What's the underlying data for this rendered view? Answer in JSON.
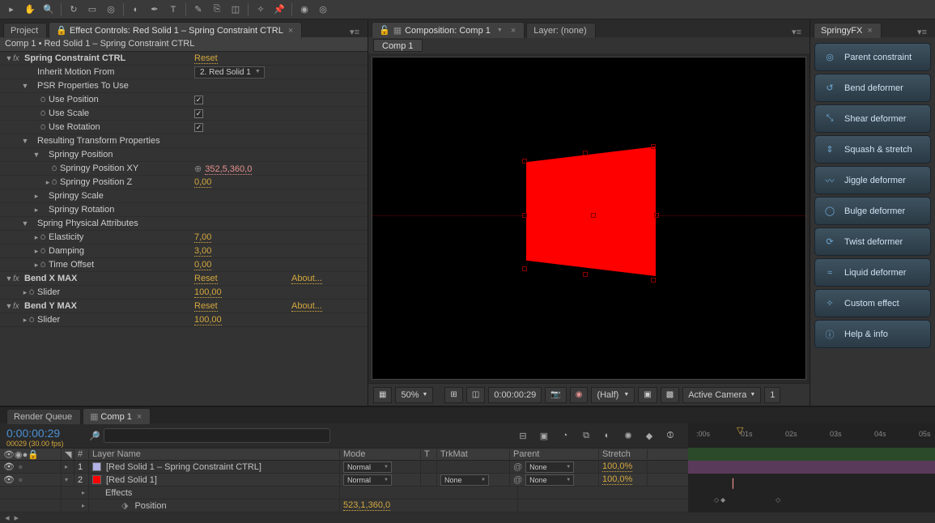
{
  "toolbar": {
    "icons": [
      "pointer",
      "hand",
      "zoom",
      "orbit",
      "camera",
      "dolly",
      "roto",
      "pen",
      "text",
      "brush",
      "clone",
      "pin",
      "puppet",
      "anchor"
    ]
  },
  "leftPanel": {
    "tabs": {
      "project": "Project",
      "effectControls": "Effect Controls: Red Solid 1 – Spring Constraint CTRL"
    },
    "crumb": "Comp 1 • Red Solid 1 – Spring Constraint CTRL",
    "fx": [
      {
        "name": "Spring Constraint CTRL",
        "reset": "Reset",
        "rows": [
          {
            "indent": 1,
            "type": "label",
            "label": "Inherit Motion From",
            "ctrl": "dd",
            "val": "2. Red Solid 1"
          },
          {
            "indent": 1,
            "type": "group",
            "tw": "▼",
            "label": "PSR Properties To Use"
          },
          {
            "indent": 2,
            "type": "check",
            "stop": "Ö",
            "label": "Use Position",
            "checked": true
          },
          {
            "indent": 2,
            "type": "check",
            "stop": "Ö",
            "label": "Use Scale",
            "checked": true
          },
          {
            "indent": 2,
            "type": "check",
            "stop": "Ö",
            "label": "Use Rotation",
            "checked": true
          },
          {
            "indent": 1,
            "type": "group",
            "tw": "▼",
            "label": "Resulting Transform Properties"
          },
          {
            "indent": 2,
            "type": "group",
            "tw": "▼",
            "label": "Springy Position"
          },
          {
            "indent": 3,
            "type": "value",
            "stop": "Ö",
            "label": "Springy Position XY",
            "pre": "⊕",
            "val": "352,5,360,0",
            "valClass": "pinkv"
          },
          {
            "indent": 3,
            "type": "value",
            "tw": "▸",
            "stop": "Ö",
            "label": "Springy Position Z",
            "val": "0,00",
            "valClass": "orange"
          },
          {
            "indent": 2,
            "type": "group",
            "tw": "▸",
            "label": "Springy Scale"
          },
          {
            "indent": 2,
            "type": "group",
            "tw": "▸",
            "label": "Springy Rotation"
          },
          {
            "indent": 1,
            "type": "group",
            "tw": "▼",
            "label": "Spring Physical Attributes"
          },
          {
            "indent": 2,
            "type": "value",
            "tw": "▸",
            "stop": "Ö",
            "label": "Elasticity",
            "val": "7,00",
            "valClass": "orange"
          },
          {
            "indent": 2,
            "type": "value",
            "tw": "▸",
            "stop": "Ö",
            "label": "Damping",
            "val": "3,00",
            "valClass": "orange"
          },
          {
            "indent": 2,
            "type": "value",
            "tw": "▸",
            "stop": "Ö",
            "label": "Time Offset",
            "val": "0,00",
            "valClass": "orange"
          }
        ]
      },
      {
        "name": "Bend X MAX",
        "reset": "Reset",
        "about": "About...",
        "rows": [
          {
            "indent": 1,
            "type": "value",
            "tw": "▸",
            "stop": "Ö",
            "label": "Slider",
            "val": "100,00",
            "valClass": "orange"
          }
        ]
      },
      {
        "name": "Bend Y MAX",
        "reset": "Reset",
        "about": "About...",
        "rows": [
          {
            "indent": 1,
            "type": "value",
            "tw": "▸",
            "stop": "Ö",
            "label": "Slider",
            "val": "100,00",
            "valClass": "orange"
          }
        ]
      }
    ]
  },
  "centerPanel": {
    "tabs": {
      "composition": "Composition: Comp 1",
      "layer": "Layer: (none)"
    },
    "subtab": "Comp 1",
    "footer": {
      "zoom": "50%",
      "timecode": "0:00:00:29",
      "quality": "(Half)",
      "camera": "Active Camera",
      "viewcount": "1"
    }
  },
  "springy": {
    "title": "SpringyFX",
    "buttons": [
      "Parent constraint",
      "Bend deformer",
      "Shear deformer",
      "Squash & stretch",
      "Jiggle deformer",
      "Bulge deformer",
      "Twist deformer",
      "Liquid deformer",
      "Custom effect",
      "Help & info"
    ]
  },
  "timeline": {
    "tabs": {
      "renderQueue": "Render Queue",
      "comp": "Comp 1"
    },
    "timecodeBig": "0:00:00:29",
    "timecodeSmall": "00029 (30.00 fps)",
    "ruler": [
      ":00s",
      "01s",
      "02s",
      "03s",
      "04s",
      "05s"
    ],
    "header": {
      "idx": "#",
      "layerName": "Layer Name",
      "mode": "Mode",
      "t": "T",
      "trkmat": "TrkMat",
      "parent": "Parent",
      "stretch": "Stretch"
    },
    "layers": [
      {
        "idx": "1",
        "swatch": "#b2b2e6",
        "name": "[Red Solid 1 – Spring Constraint CTRL]",
        "mode": "Normal",
        "trkmat": "",
        "parent": "None",
        "stretch": "100,0%"
      },
      {
        "idx": "2",
        "swatch": "#ff0000",
        "name": "[Red Solid 1]",
        "mode": "Normal",
        "trkmat": "None",
        "parent": "None",
        "stretch": "100,0%"
      }
    ],
    "sub": [
      {
        "label": "Effects"
      },
      {
        "label": "Position",
        "val": "523,1,360,0",
        "key": true
      }
    ]
  }
}
